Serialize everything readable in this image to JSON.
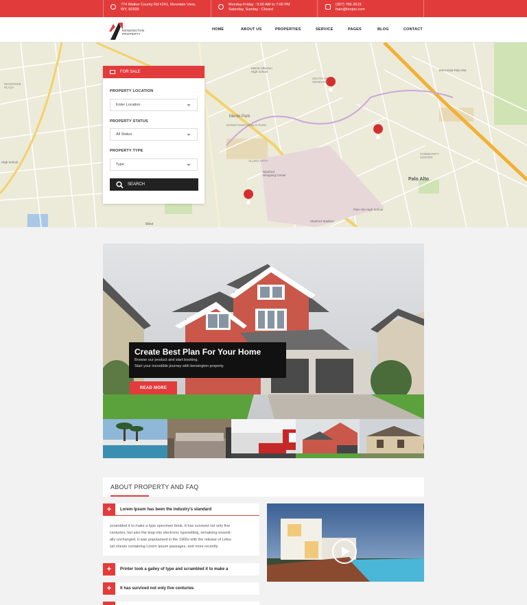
{
  "topbar": {
    "address_line1": "774 Walker County Rd #241, Mountain View,",
    "address_line2": "WY, 82939",
    "hours_line1": "Monday-Friday : 9:00 AM to 7:00 PM",
    "hours_line2": "Saturday, Sunday : Closed",
    "phone": "(307) 786-2619",
    "email": "halo@tonjoo.com"
  },
  "logo": {
    "line1": "KENSINGTON",
    "line2": "PROPERTY"
  },
  "nav": [
    "HOME",
    "ABOUT US",
    "PROPERTIES",
    "SERVICE",
    "PAGES",
    "BLOG",
    "CONTACT"
  ],
  "map_labels": {
    "palo_alto": "Palo Alto",
    "menlo_park": "Menlo Park",
    "stanford": "Stanford Shopping Center",
    "high_school": "High School",
    "woodside": "WOODSIDE PLAZA",
    "west": "West",
    "allied": "ALLIED ARTS",
    "palo_alto_hs": "Palo Alto High School",
    "stanford_stadium": "Stanford Stadium",
    "community": "COMMUNITY CENTER",
    "menlo_atherton": "Menlo-Atherton High School",
    "ikea": "IKEA East Palo Alto",
    "downtown": "DOWNTOWN MENLO PARK",
    "seminary": "SOUTH OF SEMINARY"
  },
  "search": {
    "tab_label": "FOR SALE",
    "location_label": "PROPERTY LOCATION",
    "location_value": "Enter Location",
    "status_label": "PROPERTY STATUS",
    "status_value": "All Status",
    "type_label": "PROPERTY TYPE",
    "type_value": "Type",
    "button_label": "SEARCH"
  },
  "hero": {
    "title": "Create Best Plan For Your Home",
    "text1": "Browse our product and start booking.",
    "text2": "Start your incredible journey with kensington property.",
    "button": "READ MORE"
  },
  "about": {
    "title": "ABOUT PROPERTY AND FAQ",
    "items": [
      {
        "title": "Lorem Ipsum has been the industry's standard",
        "body": [
          "scrambled it to make a type specimen book. It has survived not only five",
          "centuries, but also the leap into electronic typesetting, remaining essenti-",
          "ally unchanged. It was popularised in the 1960s with the release of Letra-",
          "set sheets containing Lorem Ipsum passages, and more recently"
        ]
      },
      {
        "title": "Printer took a galley of type and scrambled it to make a"
      },
      {
        "title": "It has survived not only five centuries"
      }
    ]
  },
  "colors": {
    "accent": "#e23b3b",
    "dark": "#222222"
  }
}
